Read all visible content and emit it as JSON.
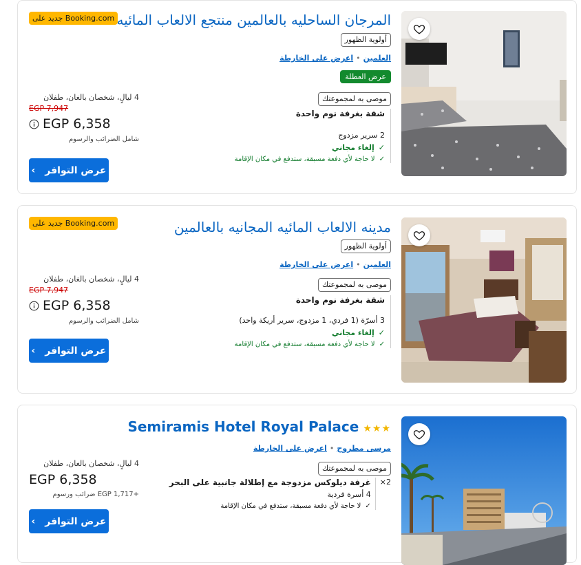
{
  "listings": [
    {
      "title": "المرجان الساحليه بالعالمين منتجع الالعاب المائيه",
      "priority_chip": "أولوية الظهور",
      "location": "العلمين",
      "show_on_map": "اعرض على الخارطة",
      "deal": "عرض العطلة",
      "recommended": "موصى به لمجموعتك",
      "room_name": "شقة بغرفة نوم واحدة",
      "beds": "2 سرير مزدوج",
      "free_cancel": "إلغاء مجاني",
      "no_prepay": "لا حاجة لأي دفعة مسبقة، ستدفع في مكان الإقامة",
      "badge": "جديد على Booking.com",
      "stay_info": "4 ليالٍ، شخصان بالغان، طفلان",
      "old_price": "EGP 7,947",
      "price": "EGP 6,358",
      "taxes": "شامل الضرائب والرسوم",
      "cta": "عرض التوافر"
    },
    {
      "title": "مدينه الالعاب المائيه المجانيه بالعالمين",
      "priority_chip": "أولوية الظهور",
      "location": "العلمين",
      "show_on_map": "اعرض على الخارطة",
      "recommended": "موصى به لمجموعتك",
      "room_name": "شقة بغرفة نوم واحدة",
      "beds": "3 أسرّة (1 فردي، 1 مزدوج، سرير أريكة واحد)",
      "free_cancel": "إلغاء مجاني",
      "no_prepay": "لا حاجة لأي دفعة مسبقة، ستدفع في مكان الإقامة",
      "badge": "جديد على Booking.com",
      "stay_info": "4 ليالٍ، شخصان بالغان، طفلان",
      "old_price": "EGP 7,947",
      "price": "EGP 6,358",
      "taxes": "شامل الضرائب والرسوم",
      "cta": "عرض التوافر"
    },
    {
      "title": "Semiramis Hotel Royal Palace",
      "stars": "★★★",
      "location": "مرسى مطروح",
      "show_on_map": "اعرض على الخارطة",
      "recommended": "موصى به لمجموعتك",
      "room_qty": "2×",
      "room_name": "غرفة ديلوكس مزدوجة مع إطلالة جانبية على البحر",
      "beds": "4 أسرة فردية",
      "no_prepay": "لا حاجة لأي دفعة مسبقة، ستدفع في مكان الإقامة",
      "stay_info": "4 ليالٍ، شخصان بالغان، طفلان",
      "price": "EGP 6,358",
      "taxes": "+EGP 1,717 ضرائب ورسوم",
      "cta": "عرض التوافر"
    }
  ]
}
